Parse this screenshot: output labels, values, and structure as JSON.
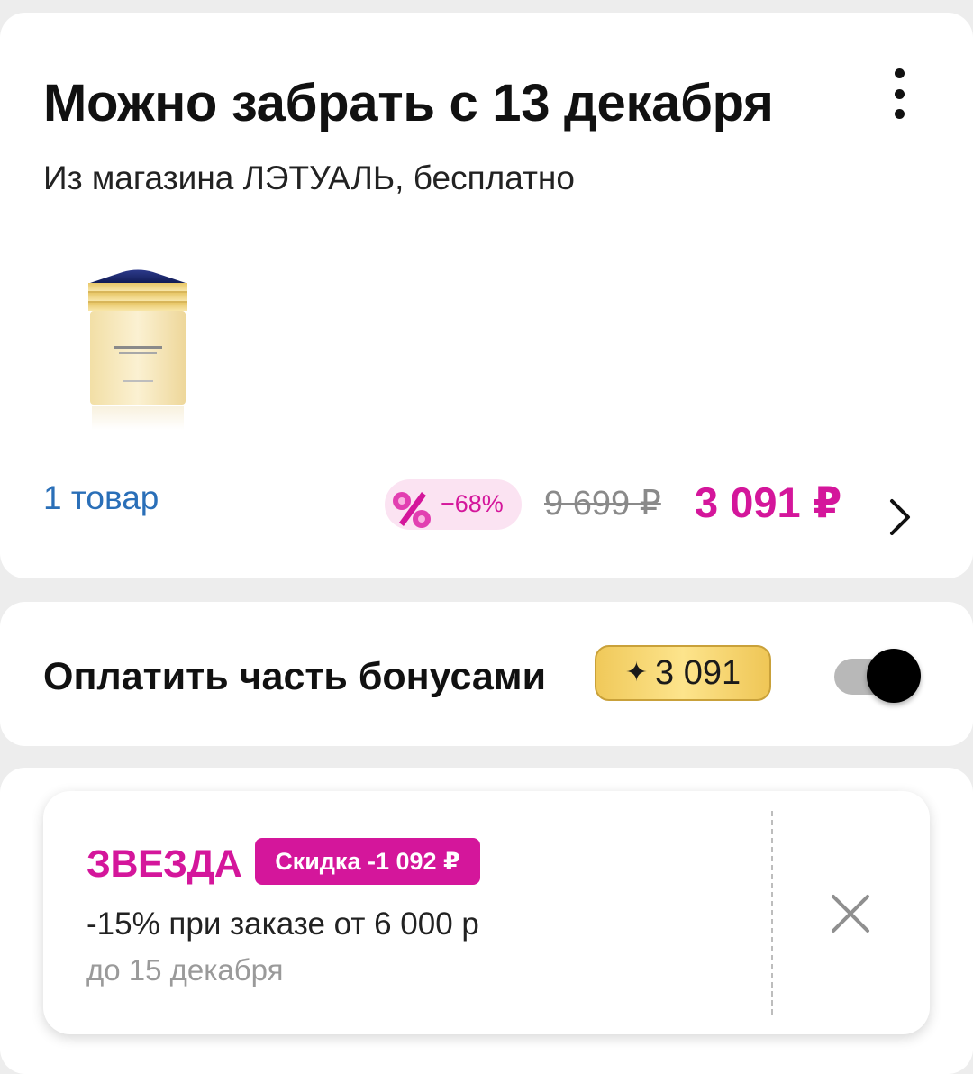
{
  "delivery": {
    "title": "Можно забрать с 13 декабря",
    "subtitle": "Из магазина ЛЭТУАЛЬ, бесплатно",
    "items_link": "1 товар",
    "discount": "−68%",
    "old_price": "9 699 ₽",
    "new_price": "3 091 ₽",
    "menu_icon": "more-vertical-icon",
    "chevron_icon": "chevron-right-icon"
  },
  "bonus": {
    "label": "Оплатить часть бонусами",
    "star": "✦",
    "amount": "3 091",
    "toggle_on": true
  },
  "promo": {
    "name": "ЗВЕЗДА",
    "tag": "Скидка -1 092 ₽",
    "description": "-15% при заказе от 6 000 р",
    "expiry": "до 15 декабря",
    "close_icon": "close-icon"
  },
  "colors": {
    "accent_pink": "#d4169b",
    "link_blue": "#2a6fb8",
    "gold": "#f0c95a",
    "background": "#ededed"
  }
}
